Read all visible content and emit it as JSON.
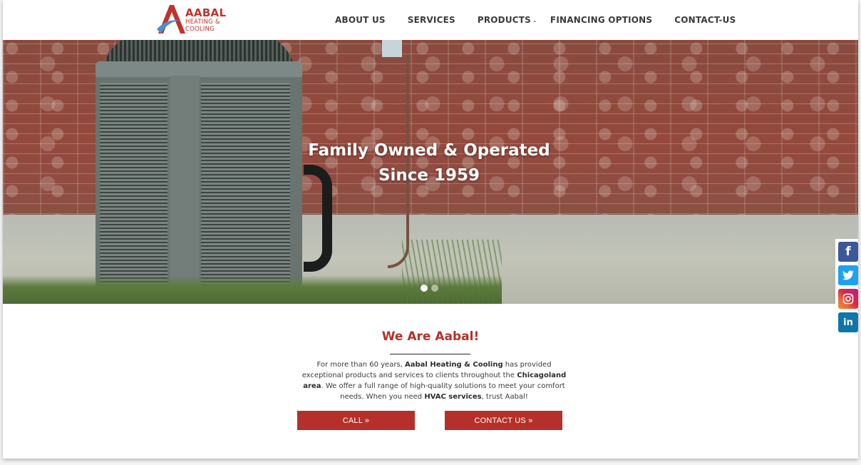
{
  "brand": {
    "name": "AABAL",
    "subtitle_line1": "HEATING &",
    "subtitle_line2": "COOLING",
    "colors": {
      "primary_red": "#b5302a",
      "logo_blue": "#4a8fce"
    }
  },
  "nav": {
    "items": [
      {
        "label": "ABOUT US"
      },
      {
        "label": "SERVICES"
      },
      {
        "label": "PRODUCTS",
        "has_dropdown": true,
        "dropdown_icon": "⌄"
      },
      {
        "label": "FINANCING OPTIONS"
      },
      {
        "label": "CONTACT-US"
      }
    ]
  },
  "hero": {
    "title_line1": "Family Owned & Operated",
    "title_line2": "Since 1959",
    "slides_total": 2,
    "active_slide": 1
  },
  "social": {
    "items": [
      {
        "name": "facebook",
        "glyph": "f",
        "color": "#3b5998"
      },
      {
        "name": "twitter",
        "glyph": "🐦",
        "color": "#1da1f2"
      },
      {
        "name": "instagram",
        "glyph": "◎",
        "color": "#dc2743"
      },
      {
        "name": "linkedin",
        "glyph": "in",
        "color": "#0e76a8"
      }
    ]
  },
  "intro": {
    "heading": "We Are Aabal!",
    "text": {
      "p1": "For more than 60 years, ",
      "b1": "Aabal Heating & Cooling",
      "p2": " has provided exceptional products and services to clients throughout the ",
      "b2": "Chicagoland area",
      "p3": ". We offer a full range of high-quality solutions to meet your comfort needs. When you need ",
      "b3": "HVAC services",
      "p4": ", trust Aabal!"
    },
    "buttons": {
      "call_label": "CALL »",
      "contact_label": "CONTACT US »"
    }
  }
}
